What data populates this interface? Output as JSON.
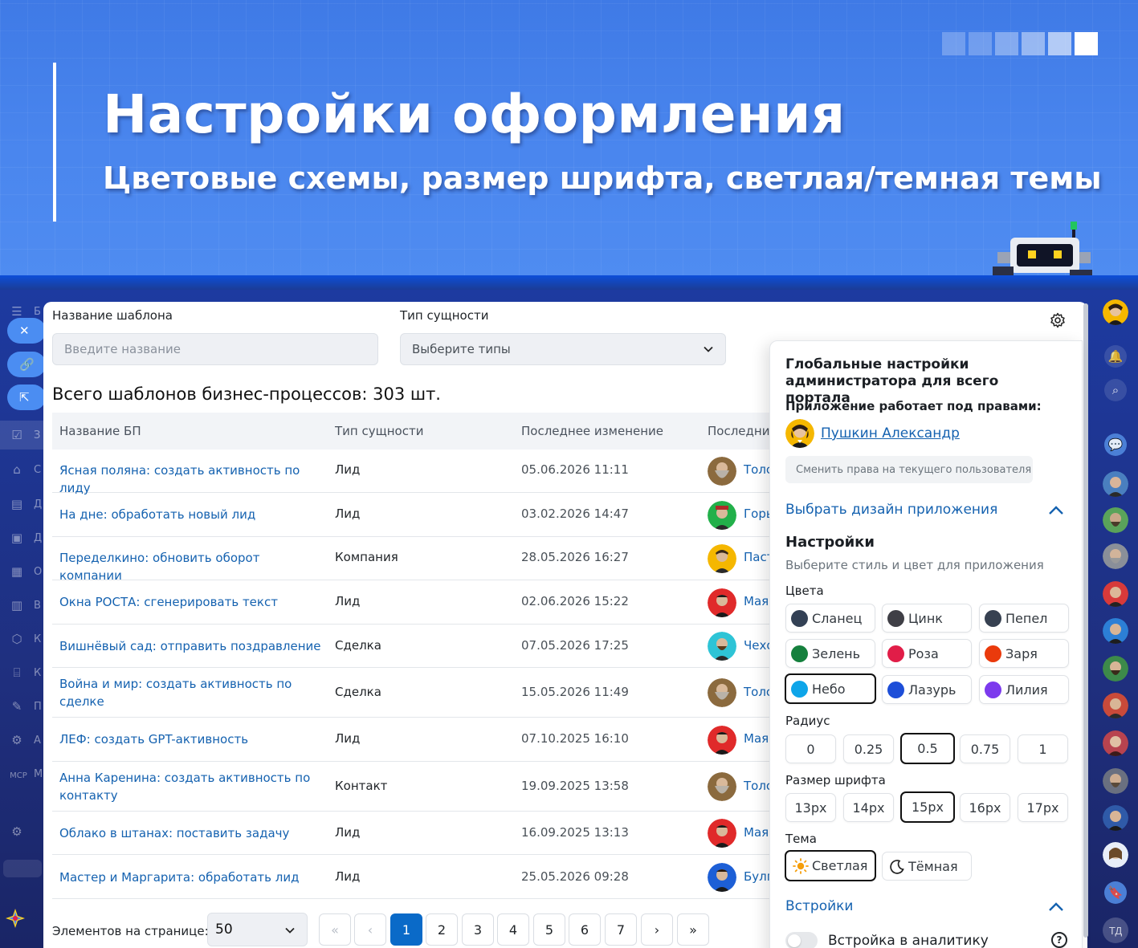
{
  "banner": {
    "title": "Настройки оформления",
    "subtitle": "Цветовые схемы, размер шрифта, светлая/темная темы"
  },
  "filters": {
    "name_label": "Название шаблона",
    "name_placeholder": "Введите название",
    "type_label": "Тип сущности",
    "type_value": "Выберите типы"
  },
  "total": "Всего шаблонов бизнес-процессов: 303 шт.",
  "table": {
    "headers": [
      "Название БП",
      "Тип сущности",
      "Последнее изменение",
      "Последни"
    ],
    "rows": [
      {
        "name": "Ясная поляна: создать активность по лиду",
        "type": "Лид",
        "date": "05.06.2026 11:11",
        "user": "Толс",
        "avatar": "tolstoy"
      },
      {
        "name": "На дне: обработать новый лид",
        "type": "Лид",
        "date": "03.02.2026 14:47",
        "user": "Горь",
        "avatar": "gorky"
      },
      {
        "name": "Переделкино: обновить оборот компании",
        "type": "Компания",
        "date": "28.05.2026 16:27",
        "user": "Паст",
        "avatar": "pasternak"
      },
      {
        "name": "Окна РОСТА: сгенерировать текст",
        "type": "Лид",
        "date": "02.06.2026 15:22",
        "user": "Маяк",
        "avatar": "mayakovsky"
      },
      {
        "name": "Вишнёвый сад: отправить поздравление",
        "type": "Сделка",
        "date": "07.05.2026 17:25",
        "user": "Чехо",
        "avatar": "chekhov"
      },
      {
        "name": "Война и мир: создать активность по сделке",
        "type": "Сделка",
        "date": "15.05.2026 11:49",
        "user": "Толс",
        "avatar": "tolstoy"
      },
      {
        "name": "ЛЕФ: создать GPT-активность",
        "type": "Лид",
        "date": "07.10.2025 16:10",
        "user": "Маяк",
        "avatar": "mayakovsky"
      },
      {
        "name": "Анна Каренина: создать активность по контакту",
        "type": "Контакт",
        "date": "19.09.2025 13:58",
        "user": "Толс",
        "avatar": "tolstoy"
      },
      {
        "name": "Облако в штанах: поставить задачу",
        "type": "Лид",
        "date": "16.09.2025 13:13",
        "user": "Маяк",
        "avatar": "mayakovsky"
      },
      {
        "name": "Мастер и Маргарита: обработать лид",
        "type": "Лид",
        "date": "25.05.2026 09:28",
        "user": "Булг",
        "avatar": "bulgakov"
      }
    ]
  },
  "pager": {
    "label": "Элементов на странице:",
    "per_page": "50",
    "first": "«",
    "prev": "‹",
    "pages": [
      "1",
      "2",
      "3",
      "4",
      "5",
      "6",
      "7"
    ],
    "current": "1",
    "next": "›",
    "last": "»"
  },
  "settings": {
    "title": "Глобальные настройки администратора для всего портала",
    "rights_label": "Приложение работает под правами:",
    "user": "Пушкин Александр",
    "change_rights": "Сменить права на текущего пользователя",
    "design_section": "Выбрать дизайн приложения",
    "heading": "Настройки",
    "description": "Выберите стиль и цвет для приложения",
    "colors_label": "Цвета",
    "colors": [
      {
        "name": "Сланец",
        "color": "#334155"
      },
      {
        "name": "Цинк",
        "color": "#3f3f46"
      },
      {
        "name": "Пепел",
        "color": "#374151"
      },
      {
        "name": "Зелень",
        "color": "#15803d"
      },
      {
        "name": "Роза",
        "color": "#e11d48"
      },
      {
        "name": "Заря",
        "color": "#ea3a0c"
      },
      {
        "name": "Небо",
        "color": "#0ea5e9"
      },
      {
        "name": "Лазурь",
        "color": "#1d4ed8"
      },
      {
        "name": "Лилия",
        "color": "#7c3aed"
      }
    ],
    "selected_color": "Небо",
    "radius_label": "Радиус",
    "radius": [
      "0",
      "0.25",
      "0.5",
      "0.75",
      "1"
    ],
    "selected_radius": "0.5",
    "font_label": "Размер шрифта",
    "font_sizes": [
      "13px",
      "14px",
      "15px",
      "16px",
      "17px"
    ],
    "selected_font": "15px",
    "theme_label": "Тема",
    "themes": {
      "light": "Светлая",
      "dark": "Тёмная"
    },
    "selected_theme": "Светлая",
    "embeds_section": "Встройки",
    "embed_item": "Встройка в аналитику",
    "help": "?"
  },
  "sidebar_letters": [
    "Б",
    "З",
    "С",
    "Д",
    "Д",
    "О",
    "В",
    "К",
    "К",
    "П",
    "А",
    "МСР",
    "М"
  ],
  "right_sidebar": {
    "initials": "ТД"
  },
  "accent": "#0a6ac8"
}
